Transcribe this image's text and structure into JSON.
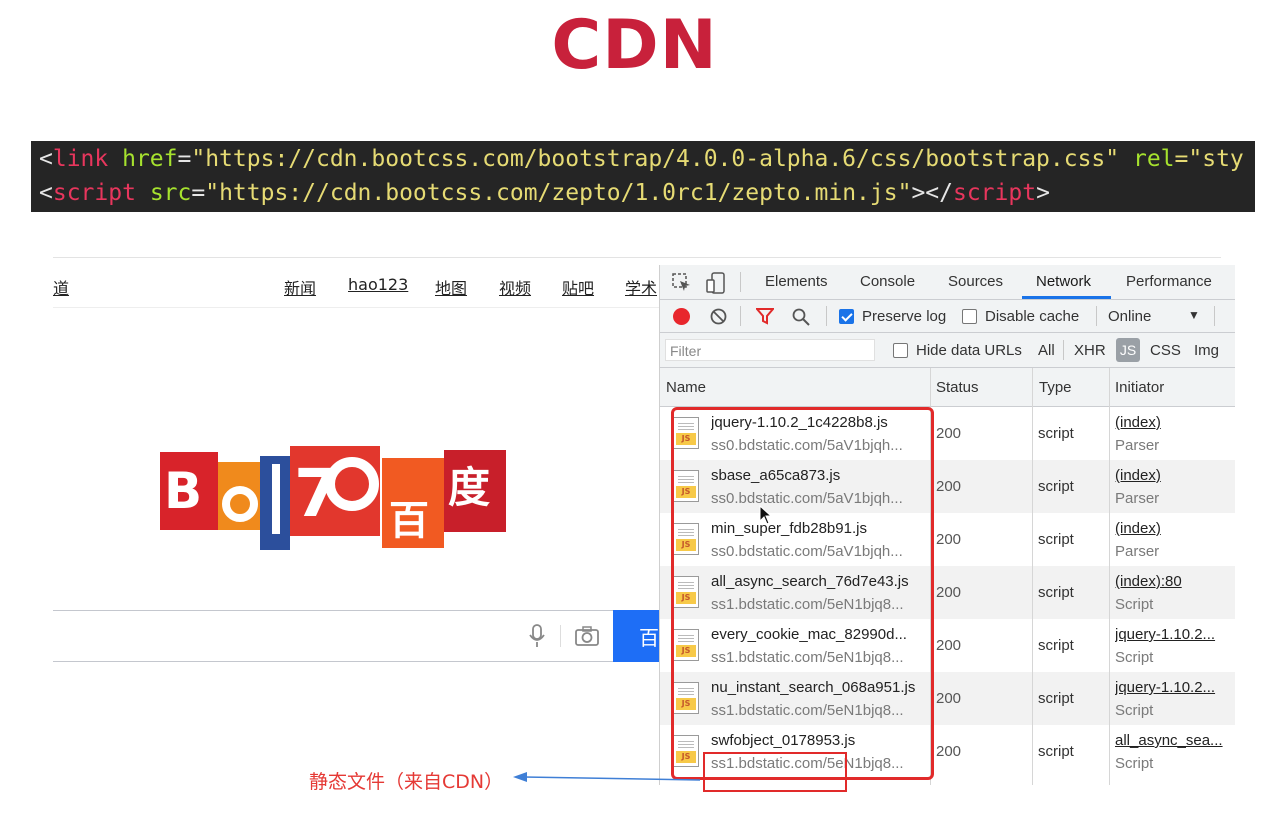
{
  "slide": {
    "title": "CDN"
  },
  "code": {
    "line1": {
      "open": "<",
      "tag": "link",
      "attr1": "href",
      "eq": "=",
      "val1": "\"https://cdn.bootcss.com/bootstrap/4.0.0-alpha.6/css/bootstrap.css\"",
      "attr2": "rel",
      "rest": "=\"sty"
    },
    "line2": {
      "open": "<",
      "tag": "script",
      "attr1": "src",
      "eq": "=",
      "val1": "\"https://cdn.bootcss.com/zepto/1.0rc1/zepto.min.js\"",
      "close": "></",
      "tag2": "script",
      "end": ">"
    }
  },
  "baidu": {
    "nav": [
      "道",
      "新闻",
      "hao123",
      "地图",
      "视频",
      "贴吧",
      "学术"
    ],
    "search_button": "百"
  },
  "devtools": {
    "tabs": [
      "Elements",
      "Console",
      "Sources",
      "Network",
      "Performance"
    ],
    "active_tab": "Network",
    "toolbar": {
      "preserve_log": "Preserve log",
      "disable_cache": "Disable cache",
      "throttle": "Online"
    },
    "filterbar": {
      "filter_placeholder": "Filter",
      "hide_data_urls": "Hide data URLs",
      "types": [
        "All",
        "XHR",
        "JS",
        "CSS",
        "Img"
      ]
    },
    "columns": {
      "name": "Name",
      "status": "Status",
      "type": "Type",
      "initiator": "Initiator"
    },
    "rows": [
      {
        "name": "jquery-1.10.2_1c4228b8.js",
        "domain": "ss0.bdstatic.com/5aV1bjqh...",
        "status": "200",
        "type": "script",
        "initiator": "(index)",
        "initiator_type": "Parser"
      },
      {
        "name": "sbase_a65ca873.js",
        "domain": "ss0.bdstatic.com/5aV1bjqh...",
        "status": "200",
        "type": "script",
        "initiator": "(index)",
        "initiator_type": "Parser"
      },
      {
        "name": "min_super_fdb28b91.js",
        "domain": "ss0.bdstatic.com/5aV1bjqh...",
        "status": "200",
        "type": "script",
        "initiator": "(index)",
        "initiator_type": "Parser"
      },
      {
        "name": "all_async_search_76d7e43.js",
        "domain": "ss1.bdstatic.com/5eN1bjq8...",
        "status": "200",
        "type": "script",
        "initiator": "(index):80",
        "initiator_type": "Script"
      },
      {
        "name": "every_cookie_mac_82990d...",
        "domain": "ss1.bdstatic.com/5eN1bjq8...",
        "status": "200",
        "type": "script",
        "initiator": "jquery-1.10.2...",
        "initiator_type": "Script"
      },
      {
        "name": "nu_instant_search_068a951.js",
        "domain": "ss1.bdstatic.com/5eN1bjq8...",
        "status": "200",
        "type": "script",
        "initiator": "jquery-1.10.2...",
        "initiator_type": "Script"
      },
      {
        "name": "swfobject_0178953.js",
        "domain": "ss1.bdstatic.com/5eN1bjq8...",
        "status": "200",
        "type": "script",
        "initiator": "all_async_sea...",
        "initiator_type": "Script"
      }
    ]
  },
  "annotation": "静态文件（来自CDN）",
  "colors": {
    "title": "#c8213b",
    "highlight": "#e12a2a",
    "arrow": "#3f7fd6",
    "search_button": "#1e6ef6"
  }
}
